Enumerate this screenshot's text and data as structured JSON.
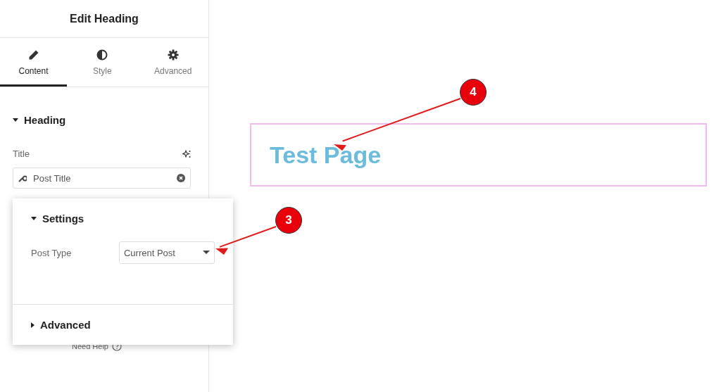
{
  "panel": {
    "title": "Edit Heading",
    "tabs": [
      {
        "label": "Content",
        "selected": true
      },
      {
        "label": "Style",
        "selected": false
      },
      {
        "label": "Advanced",
        "selected": false
      }
    ],
    "section": {
      "title": "Heading",
      "expanded": true
    },
    "title_field": {
      "label": "Title",
      "value": "Post Title"
    },
    "need_help": "Need Help"
  },
  "popup": {
    "sections": [
      {
        "title": "Settings",
        "expanded": true,
        "fields": [
          {
            "label": "Post Type",
            "value": "Current Post"
          }
        ]
      },
      {
        "title": "Advanced",
        "expanded": false
      }
    ]
  },
  "canvas": {
    "heading": "Test Page"
  },
  "annotations": [
    {
      "number": "4"
    },
    {
      "number": "3"
    }
  ]
}
